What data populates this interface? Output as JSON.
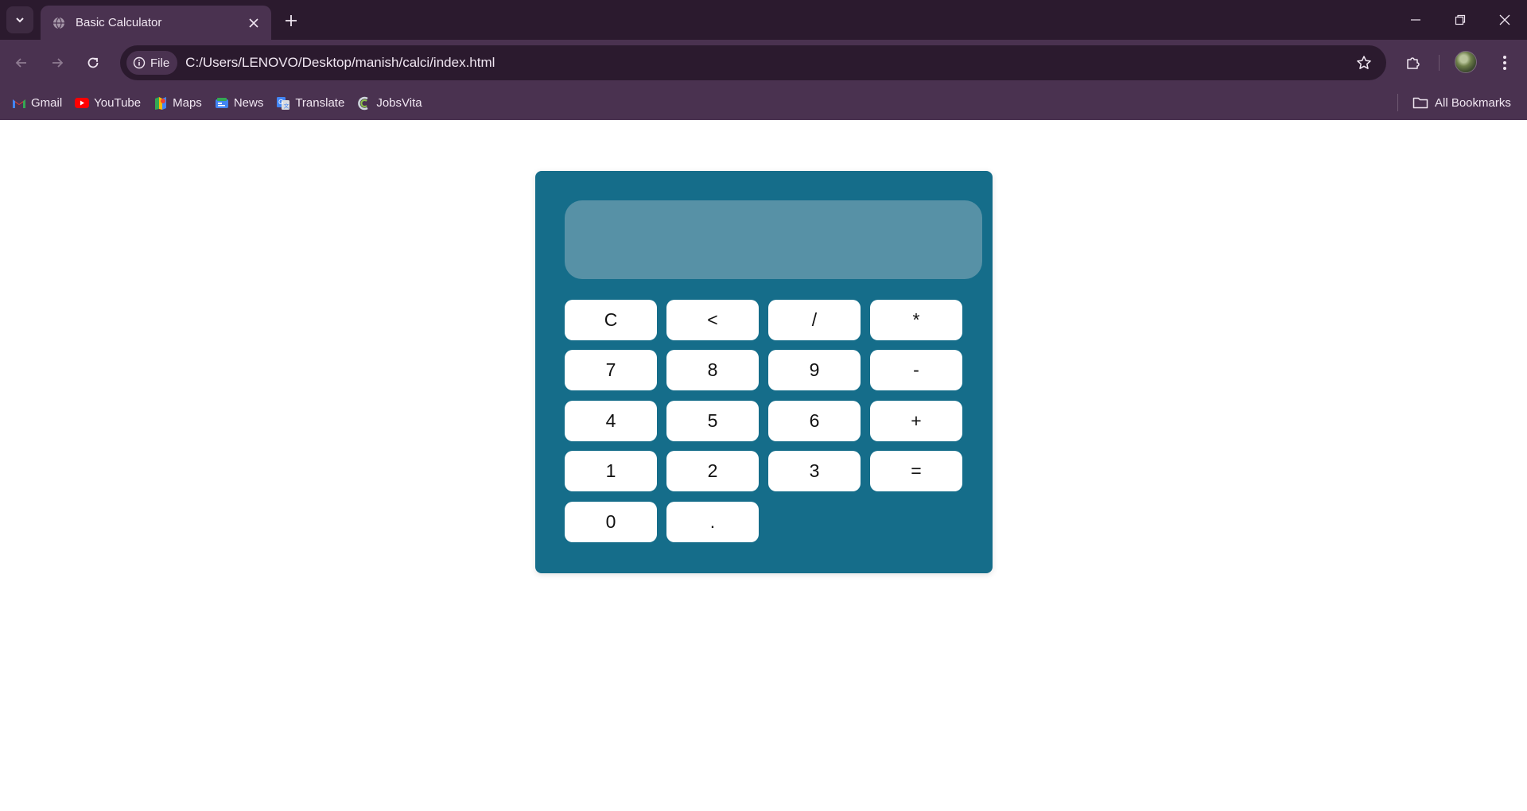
{
  "browser": {
    "tab": {
      "title": "Basic Calculator",
      "favicon": "globe-icon"
    },
    "address": {
      "site_chip": "File",
      "url": "C:/Users/LENOVO/Desktop/manish/calci/index.html"
    },
    "bookmarks": [
      {
        "label": "Gmail",
        "icon": "gmail-icon"
      },
      {
        "label": "YouTube",
        "icon": "youtube-icon"
      },
      {
        "label": "Maps",
        "icon": "maps-icon"
      },
      {
        "label": "News",
        "icon": "news-icon"
      },
      {
        "label": "Translate",
        "icon": "translate-icon"
      },
      {
        "label": "JobsVita",
        "icon": "jobsvita-icon"
      }
    ],
    "all_bookmarks": "All Bookmarks",
    "colors": {
      "chrome_dark": "#2b1a2e",
      "chrome": "#4a3250",
      "text": "#f1e7f2"
    }
  },
  "calculator": {
    "display_value": "",
    "keys": {
      "clear": "C",
      "backspace": "<",
      "divide": "/",
      "multiply": "*",
      "seven": "7",
      "eight": "8",
      "nine": "9",
      "minus": "-",
      "four": "4",
      "five": "5",
      "six": "6",
      "plus": "+",
      "one": "1",
      "two": "2",
      "three": "3",
      "equals": "=",
      "zero": "0",
      "decimal": "."
    },
    "colors": {
      "body": "#156d8a",
      "display": "#5791a6",
      "key": "#ffffff"
    }
  }
}
